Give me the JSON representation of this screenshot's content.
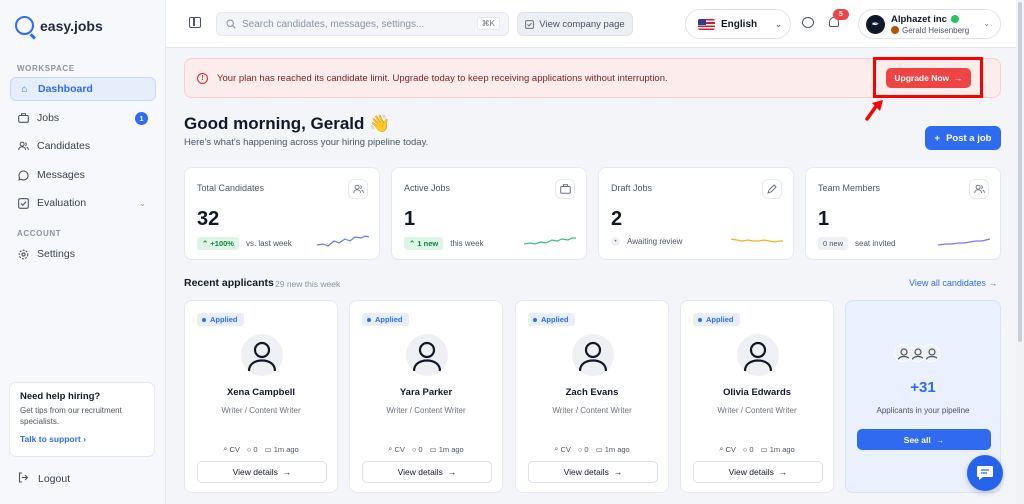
{
  "app": {
    "name": "easy.jobs"
  },
  "sidebar": {
    "workspace_label": "WORKSPACE",
    "account_label": "ACCOUNT",
    "items": [
      {
        "label": "Dashboard",
        "icon": "home-icon"
      },
      {
        "label": "Jobs",
        "icon": "briefcase-icon",
        "badge": "1"
      },
      {
        "label": "Candidates",
        "icon": "users-icon"
      },
      {
        "label": "Messages",
        "icon": "chat-icon"
      },
      {
        "label": "Evaluation",
        "icon": "checkbox-icon"
      },
      {
        "label": "Settings",
        "icon": "gear-icon"
      }
    ],
    "help": {
      "title": "Need help hiring?",
      "text": "Get tips from our recruitment specialists.",
      "link": "Talk to support"
    },
    "logout": "Logout"
  },
  "topbar": {
    "search_placeholder": "Search candidates, messages, settings...",
    "shortcut": "⌘K",
    "view_company": "View company page",
    "language": "English",
    "notification_count": "5",
    "company": "Alphazet inc",
    "user": "Gerald Heisenberg"
  },
  "alert": {
    "text": "Your plan has reached its candidate limit. Upgrade today to keep receiving applications without interruption.",
    "button": "Upgrade Now"
  },
  "header": {
    "greeting": "Good morning, Gerald 👋",
    "subtitle": "Here's what's happening across your hiring pipeline today.",
    "post_job": "Post a job"
  },
  "stats": [
    {
      "label": "Total Candidates",
      "value": "32",
      "badge": "+100%",
      "note": "vs. last week",
      "spark_color": "#5b7cf0"
    },
    {
      "label": "Active Jobs",
      "value": "1",
      "badge": "1 new",
      "note": "this week",
      "spark_color": "#34c27a"
    },
    {
      "label": "Draft Jobs",
      "value": "2",
      "badge": "",
      "note": "Awaiting review",
      "spark_color": "#f2b01e"
    },
    {
      "label": "Team Members",
      "value": "1",
      "badge": "0 new",
      "note": "seat invited",
      "spark_color": "#8b6cf0"
    }
  ],
  "recent": {
    "title": "Recent applicants",
    "subtitle": "29 new this week",
    "view_all": "View all candidates",
    "status": "Applied",
    "details_label": "View details",
    "meta": {
      "cv": "CV",
      "comments": "0",
      "time": "1m ago"
    },
    "candidates": [
      {
        "name": "Xena Campbell",
        "role": "Writer / Content Writer"
      },
      {
        "name": "Yara Parker",
        "role": "Writer / Content Writer"
      },
      {
        "name": "Zach Evans",
        "role": "Writer / Content Writer"
      },
      {
        "name": "Olivia Edwards",
        "role": "Writer / Content Writer"
      }
    ],
    "more": {
      "count": "+31",
      "text": "Applicants in your pipeline",
      "button": "See all"
    }
  },
  "colors": {
    "accent": "#2f6bf0",
    "danger": "#ef4444",
    "highlight": "#ff0000"
  }
}
